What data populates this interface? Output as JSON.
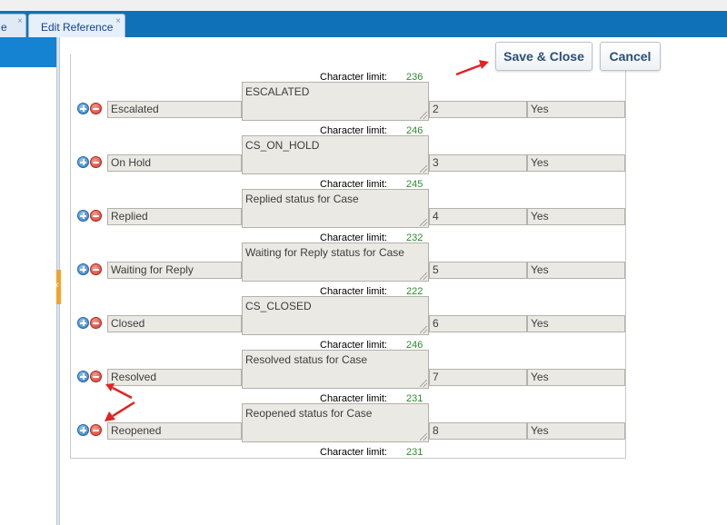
{
  "tabs": {
    "prev_label": "e",
    "active_label": "Edit Reference",
    "close_glyph": "×"
  },
  "toolbar": {
    "save_label": "Save & Close",
    "cancel_label": "Cancel"
  },
  "char_limit_label": "Character limit:",
  "top_char_limit": "236",
  "rows": [
    {
      "name": "Escalated",
      "description": "ESCALATED",
      "order": "2",
      "active": "Yes",
      "char_limit": "246"
    },
    {
      "name": "On Hold",
      "description": "CS_ON_HOLD",
      "order": "3",
      "active": "Yes",
      "char_limit": "245"
    },
    {
      "name": "Replied",
      "description": "Replied status for Case",
      "order": "4",
      "active": "Yes",
      "char_limit": "232"
    },
    {
      "name": "Waiting for Reply",
      "description": "Waiting for Reply status for Case",
      "order": "5",
      "active": "Yes",
      "char_limit": "222"
    },
    {
      "name": "Closed",
      "description": "CS_CLOSED",
      "order": "6",
      "active": "Yes",
      "char_limit": "246"
    },
    {
      "name": "Resolved",
      "description": "Resolved status for Case",
      "order": "7",
      "active": "Yes",
      "char_limit": "231"
    },
    {
      "name": "Reopened",
      "description": "Reopened status for Case",
      "order": "8",
      "active": "Yes",
      "char_limit": "231"
    }
  ],
  "colors": {
    "tabbar": "#0f72b8",
    "char_limit_value": "#2e8b2e",
    "annotation_arrow": "#e32222"
  },
  "icons": {
    "add": "plus-circle-icon",
    "remove": "minus-circle-icon"
  }
}
